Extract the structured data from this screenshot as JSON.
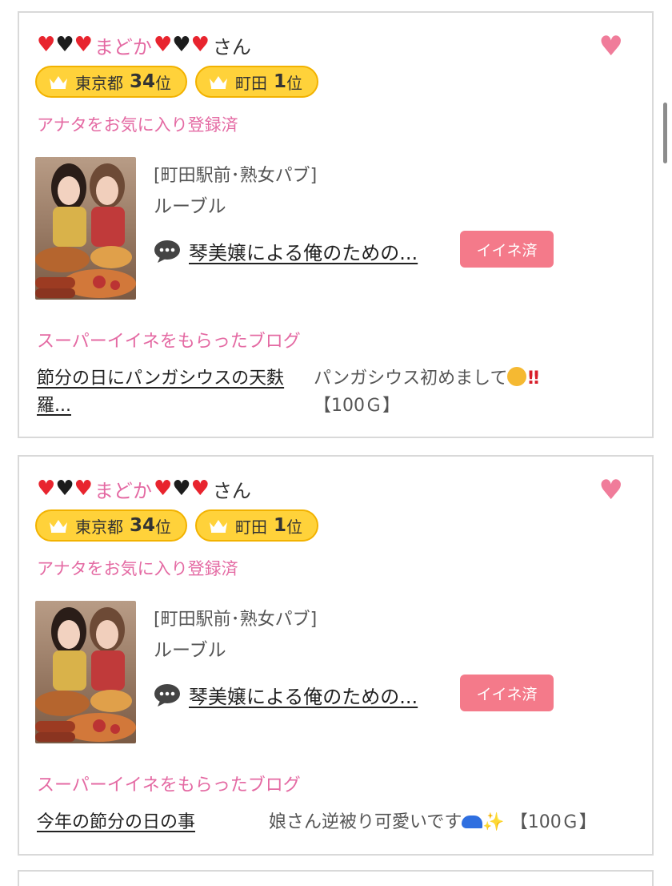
{
  "cards": [
    {
      "user": {
        "name": "まどか",
        "suffix": "さん"
      },
      "ranks": [
        {
          "area": "東京都",
          "rank": "34",
          "suffix": "位"
        },
        {
          "area": "町田",
          "rank": "1",
          "suffix": "位"
        }
      ],
      "favorite_status": "アナタをお気に入り登録済",
      "shop_category": "[町田駅前･熟女パブ]",
      "shop_name": "ルーブル",
      "comment_link": "琴美嬢による俺のための...",
      "iine_button": "イイネ済",
      "super_label": "スーパーイイネをもらったブログ",
      "blog_title": "節分の日にパンガシウスの天麩羅...",
      "blog_comment_text": "パンガシウス初めまして",
      "blog_comment_points": "【100Ｇ】"
    },
    {
      "user": {
        "name": "まどか",
        "suffix": "さん"
      },
      "ranks": [
        {
          "area": "東京都",
          "rank": "34",
          "suffix": "位"
        },
        {
          "area": "町田",
          "rank": "1",
          "suffix": "位"
        }
      ],
      "favorite_status": "アナタをお気に入り登録済",
      "shop_category": "[町田駅前･熟女パブ]",
      "shop_name": "ルーブル",
      "comment_link": "琴美嬢による俺のための...",
      "iine_button": "イイネ済",
      "super_label": "スーパーイイネをもらったブログ",
      "blog_title": "今年の節分の日の事",
      "blog_comment_text": "娘さん逆被り可愛いです",
      "blog_comment_points": "【100Ｇ】"
    }
  ],
  "colors": {
    "pink_text": "#e46aa3",
    "badge_yellow": "#ffd23a",
    "iine_button": "#f47a8a",
    "heart_red": "#e8242e"
  },
  "icons": [
    "red-heart-icon",
    "black-heart-icon",
    "favorite-heart-icon",
    "crown-icon",
    "speech-bubble-icon",
    "cat-emoji-icon",
    "double-exclamation-icon",
    "cap-emoji-icon",
    "sparkles-icon"
  ]
}
